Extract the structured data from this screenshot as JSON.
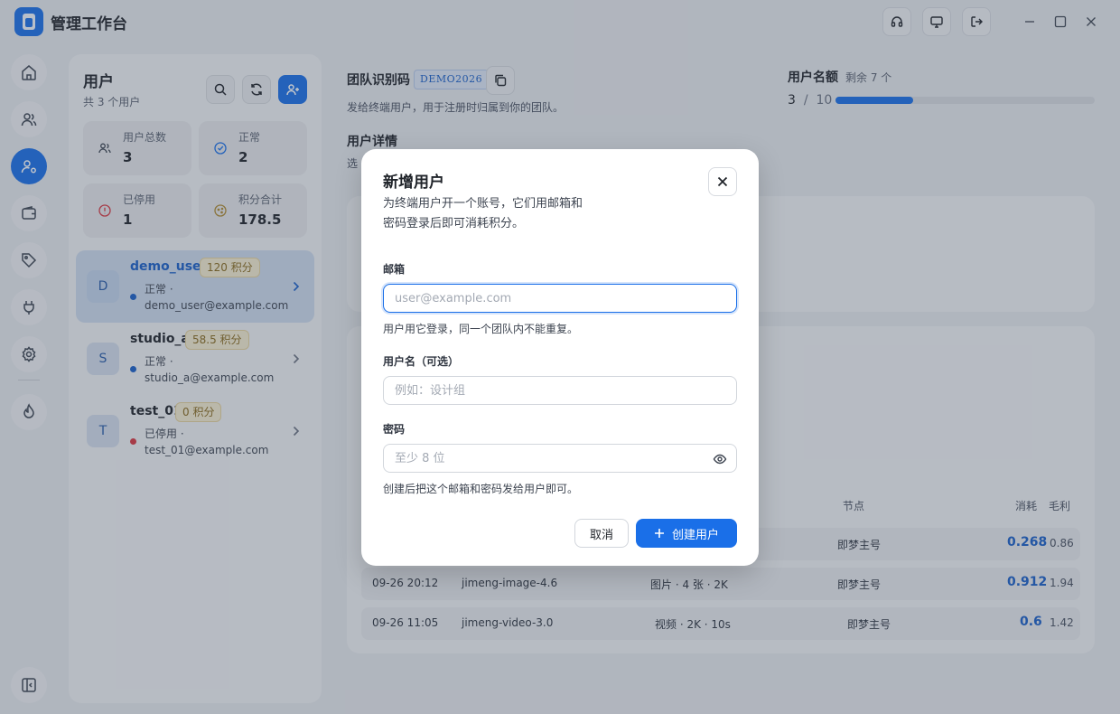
{
  "app": {
    "title": "管理工作台"
  },
  "titlebar": {
    "icons": [
      "headset-icon",
      "monitor-icon",
      "logout-icon",
      "minimize-icon",
      "maximize-icon",
      "close-icon"
    ]
  },
  "sidebar": {
    "items": [
      "home-icon",
      "users-icon",
      "user-settings-icon",
      "wallet-icon",
      "tag-icon",
      "plug-icon",
      "gear-icon",
      "fire-icon",
      "collapse-sidebar-icon"
    ],
    "active": "user-settings-icon"
  },
  "users_panel": {
    "title": "用户",
    "subtitle": "共 3 个用户",
    "stats": [
      {
        "label": "用户总数",
        "value": "3",
        "icon": "users-icon"
      },
      {
        "label": "正常",
        "value": "2",
        "icon": "check-circle-icon"
      },
      {
        "label": "已停用",
        "value": "1",
        "icon": "alert-circle-icon"
      },
      {
        "label": "积分合计",
        "value": "178.5",
        "icon": "coins-icon"
      }
    ],
    "users": [
      {
        "initial": "D",
        "name": "demo_user",
        "points": "120 积分",
        "status": "正常 ·",
        "email": "demo_user@example.com",
        "dot_color": "#1a5fc8",
        "selected": true
      },
      {
        "initial": "S",
        "name": "studio_a",
        "points": "58.5 积分",
        "status": "正常 ·",
        "email": "studio_a@example.com",
        "dot_color": "#1a5fc8",
        "selected": false
      },
      {
        "initial": "T",
        "name": "test_01",
        "points": "0 积分",
        "status": "已停用 ·",
        "email": "test_01@example.com",
        "dot_color": "#d9363e",
        "selected": false
      }
    ]
  },
  "team": {
    "label": "团队识别码",
    "code": "DEMO2026",
    "desc": "发给终端用户，用于注册时归属到你的团队。"
  },
  "quota": {
    "label": "用户名额",
    "remain": "剩余 7 个",
    "used": "3",
    "separator": "/",
    "total": "10",
    "fraction": 0.3
  },
  "detail": {
    "label": "用户详情",
    "sub": "选"
  },
  "table": {
    "headers": {
      "node": "节点",
      "cost": "消耗",
      "profit": "毛利"
    },
    "rows": [
      {
        "time": "09-26 20:12",
        "model": "jimeng-image-4.6",
        "spec": "图片 · 4 张 · 2K",
        "node": "即梦主号",
        "cost": "0.912",
        "profit": "1.94"
      },
      {
        "time": "09-26 11:05",
        "model": "jimeng-video-3.0",
        "spec": "视频 · 2K · 10s",
        "node": "即梦主号",
        "cost": "0.6",
        "profit": "1.42"
      }
    ],
    "partial_row": {
      "node": "即梦主号",
      "cost": "0.268",
      "profit": "0.86"
    }
  },
  "modal": {
    "title": "新增用户",
    "desc": "为终端用户开一个账号，它们用邮箱和密码登录后即可消耗积分。",
    "email_label": "邮箱",
    "email_placeholder": "user@example.com",
    "email_hint": "用户用它登录，同一个团队内不能重复。",
    "username_label": "用户名（可选）",
    "username_placeholder": "例如：设计组",
    "password_label": "密码",
    "password_placeholder": "至少 8 位",
    "password_hint": "创建后把这个邮箱和密码发给用户即可。",
    "cancel": "取消",
    "create": "创建用户"
  },
  "colors": {
    "accent": "#1a6fe8",
    "disabled": "#d9363e",
    "badge_bg": "#f7edd0"
  }
}
